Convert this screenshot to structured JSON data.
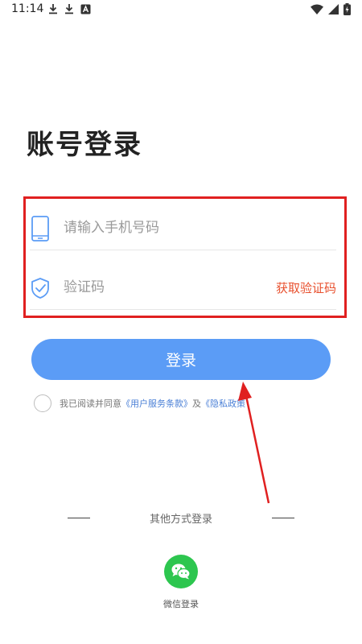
{
  "status_bar": {
    "time": "11:14",
    "left_icons": [
      "download-icon",
      "download-icon",
      "a-icon"
    ],
    "right_icons": [
      "wifi-icon",
      "signal-icon",
      "battery-charging-icon"
    ]
  },
  "title": "账号登录",
  "form": {
    "phone": {
      "icon": "phone-icon",
      "placeholder": "请输入手机号码",
      "value": ""
    },
    "code": {
      "icon": "shield-check-icon",
      "placeholder": "验证码",
      "value": "",
      "get_code_label": "获取验证码"
    },
    "highlight_color": "#e02020"
  },
  "login_button": {
    "label": "登录",
    "color": "#5b9cf6"
  },
  "agreement": {
    "checked": false,
    "prefix": "我已阅读并同意",
    "terms_link": "《用户服务条款》",
    "and": "及",
    "privacy_link": "《隐私政策",
    "link_color": "#4a7fd6"
  },
  "other_login": {
    "label": "其他方式登录",
    "wechat": {
      "icon": "wechat-icon",
      "label": "微信登录",
      "color": "#2dc64f"
    }
  },
  "colors": {
    "accent": "#5b9cf6",
    "warning": "#e8502e",
    "annotation": "#e02020"
  }
}
